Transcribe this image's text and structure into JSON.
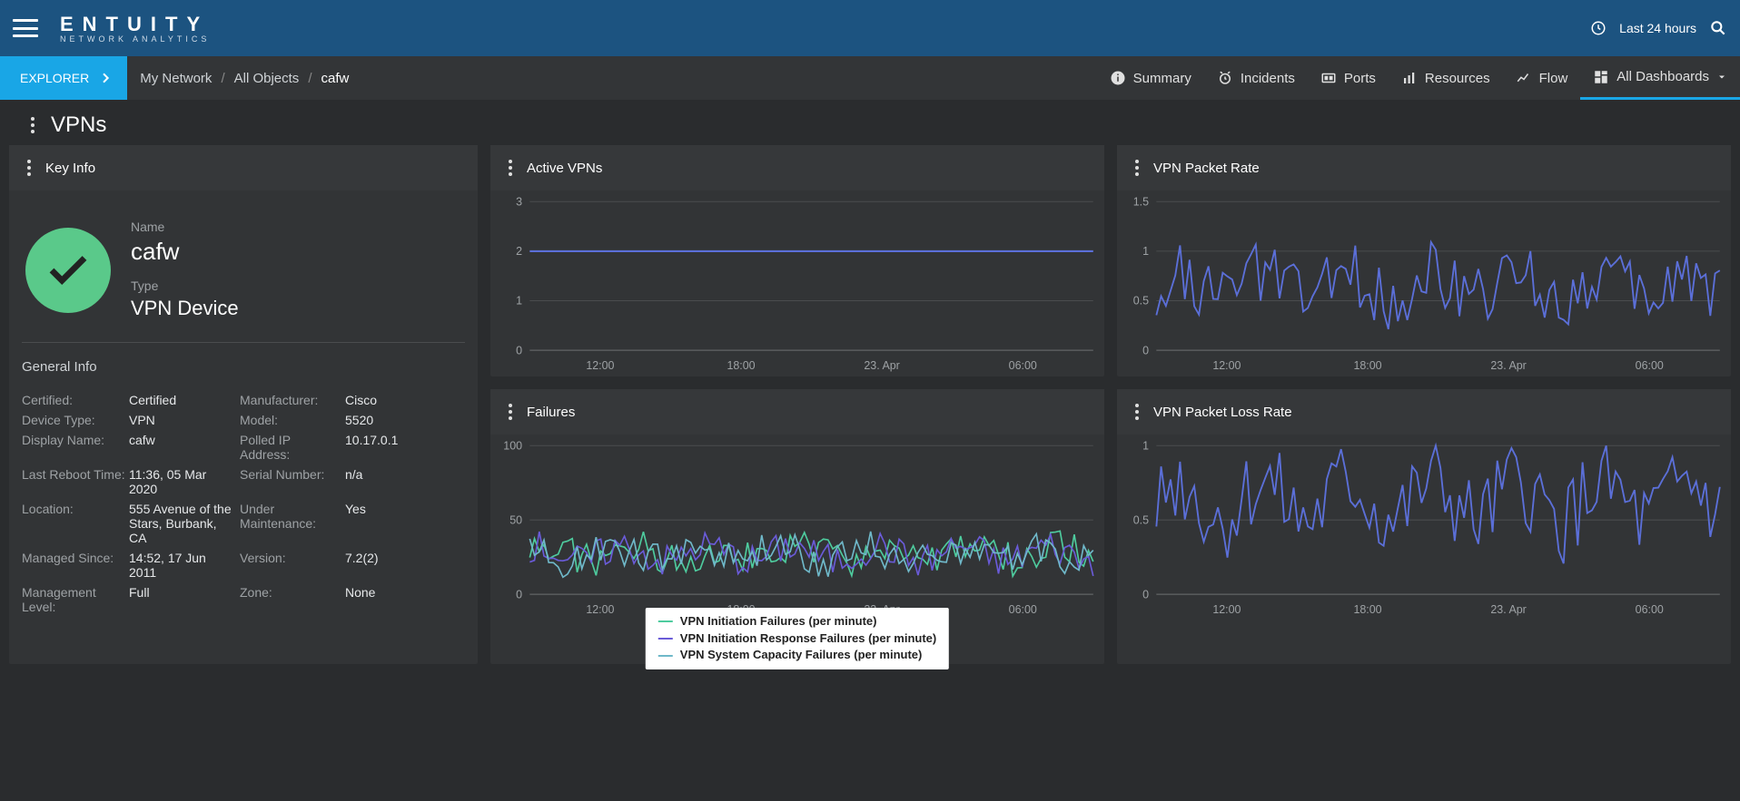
{
  "header": {
    "brand_top": "ENTUITY",
    "brand_bottom": "NETWORK ANALYTICS",
    "time_range": "Last 24 hours"
  },
  "subnav": {
    "explorer": "EXPLORER",
    "crumb1": "My Network",
    "crumb2": "All Objects",
    "crumb3": "cafw",
    "tabs": {
      "summary": "Summary",
      "incidents": "Incidents",
      "ports": "Ports",
      "resources": "Resources",
      "flow": "Flow",
      "dashboards": "All Dashboards"
    }
  },
  "page_title": "VPNs",
  "cards": {
    "keyinfo": "Key Info",
    "active": "Active VPNs",
    "packetrate": "VPN Packet Rate",
    "failures": "Failures",
    "packetloss": "VPN Packet Loss Rate"
  },
  "device": {
    "name_label": "Name",
    "name": "cafw",
    "type_label": "Type",
    "type": "VPN Device",
    "general_title": "General Info",
    "rows": {
      "certified_k": "Certified:",
      "certified_v": "Certified",
      "manufacturer_k": "Manufacturer:",
      "manufacturer_v": "Cisco",
      "devicetype_k": "Device Type:",
      "devicetype_v": "VPN",
      "model_k": "Model:",
      "model_v": "5520",
      "displayname_k": "Display Name:",
      "displayname_v": "cafw",
      "polledip_k": "Polled IP Address:",
      "polledip_v": "10.17.0.1",
      "reboot_k": "Last Reboot Time:",
      "reboot_v": "11:36, 05 Mar 2020",
      "serial_k": "Serial Number:",
      "serial_v": "n/a",
      "location_k": "Location:",
      "location_v": "555 Avenue of the Stars, Burbank, CA",
      "maint_k": "Under Maintenance:",
      "maint_v": "Yes",
      "managed_k": "Managed Since:",
      "managed_v": "14:52, 17 Jun 2011",
      "version_k": "Version:",
      "version_v": "7.2(2)",
      "mgmtlvl_k": "Management Level:",
      "mgmtlvl_v": "Full",
      "zone_k": "Zone:",
      "zone_v": "None"
    }
  },
  "x_ticks": [
    "12:00",
    "18:00",
    "23. Apr",
    "06:00"
  ],
  "legend": {
    "s1": "VPN Initiation Failures (per minute)",
    "s2": "VPN Initiation Response Failures (per minute)",
    "s3": "VPN System Capacity Failures (per minute)"
  },
  "chart_data": [
    {
      "id": "active_vpns",
      "type": "line",
      "title": "Active VPNs",
      "ylim": [
        0,
        3
      ],
      "yticks": [
        0,
        1,
        2,
        3
      ],
      "xticks": [
        "12:00",
        "18:00",
        "23. Apr",
        "06:00"
      ],
      "series": [
        {
          "name": "Active VPNs",
          "constant_value": 2
        }
      ]
    },
    {
      "id": "vpn_packet_rate",
      "type": "line",
      "title": "VPN Packet Rate",
      "ylim": [
        0,
        1.5
      ],
      "yticks": [
        0,
        0.5,
        1,
        1.5
      ],
      "xticks": [
        "12:00",
        "18:00",
        "23. Apr",
        "06:00"
      ],
      "series": [
        {
          "name": "Packet Rate",
          "range_approx": [
            0.3,
            1.0
          ],
          "note": "noisy oscillation around ~0.6"
        }
      ]
    },
    {
      "id": "failures",
      "type": "line",
      "title": "Failures",
      "ylim": [
        0,
        100
      ],
      "yticks": [
        0,
        50,
        100
      ],
      "xticks": [
        "12:00",
        "18:00",
        "23. Apr",
        "06:00"
      ],
      "series": [
        {
          "name": "VPN Initiation Failures (per minute)",
          "range_approx": [
            15,
            40
          ]
        },
        {
          "name": "VPN Initiation Response Failures (per minute)",
          "range_approx": [
            15,
            40
          ]
        },
        {
          "name": "VPN System Capacity Failures (per minute)",
          "range_approx": [
            15,
            40
          ]
        }
      ]
    },
    {
      "id": "vpn_packet_loss_rate",
      "type": "line",
      "title": "VPN Packet Loss Rate",
      "ylim": [
        0,
        1
      ],
      "yticks": [
        0,
        0.5,
        1
      ],
      "xticks": [
        "12:00",
        "18:00",
        "23. Apr",
        "06:00"
      ],
      "series": [
        {
          "name": "Packet Loss Rate",
          "range_approx": [
            0.3,
            0.95
          ],
          "note": "noisy oscillation around ~0.65"
        }
      ]
    }
  ]
}
